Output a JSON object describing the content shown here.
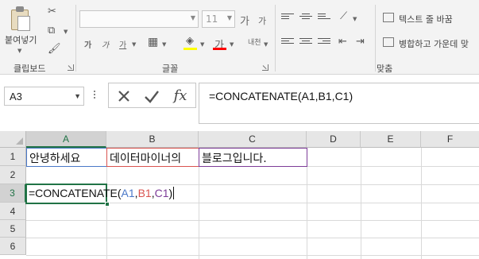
{
  "ribbon": {
    "clipboard": {
      "paste_label": "붙여넣기",
      "group_label": "클립보드"
    },
    "font": {
      "font_name": "",
      "font_size": "11",
      "grow_label": "가",
      "shrink_label": "가",
      "bold_label": "가",
      "italic_label": "가",
      "underline_label": "가",
      "phonetic_label": "내천",
      "group_label": "글꼴",
      "fill_color": "#ffff00",
      "font_color": "#ff0000"
    },
    "alignment": {
      "wrap_text_label": "텍스트 줄 바꿈",
      "merge_label": "병합하고 가운데 맞",
      "group_label": "맞춤"
    }
  },
  "formula_bar": {
    "name_box": "A3",
    "fx_label": "fx",
    "formula": "=CONCATENATE(A1,B1,C1)"
  },
  "grid": {
    "columns": [
      "A",
      "B",
      "C",
      "D",
      "E",
      "F"
    ],
    "rows": [
      "1",
      "2",
      "3",
      "4",
      "5",
      "6"
    ],
    "selected_column": "A",
    "selected_row": "3",
    "cells": {
      "A1": "안녕하세요",
      "B1": "데이터마이너의",
      "C1": "블로그입니다."
    },
    "editing": {
      "cell": "A3",
      "prefix": "=CONCATENATE(",
      "arg1": "A1",
      "sep1": ",",
      "arg2": "B1",
      "sep2": ",",
      "arg3": "C1",
      "suffix": ")"
    },
    "ref_colors": {
      "A1": "#4a78c8",
      "B1": "#d9534f",
      "C1": "#7d3c98"
    }
  }
}
